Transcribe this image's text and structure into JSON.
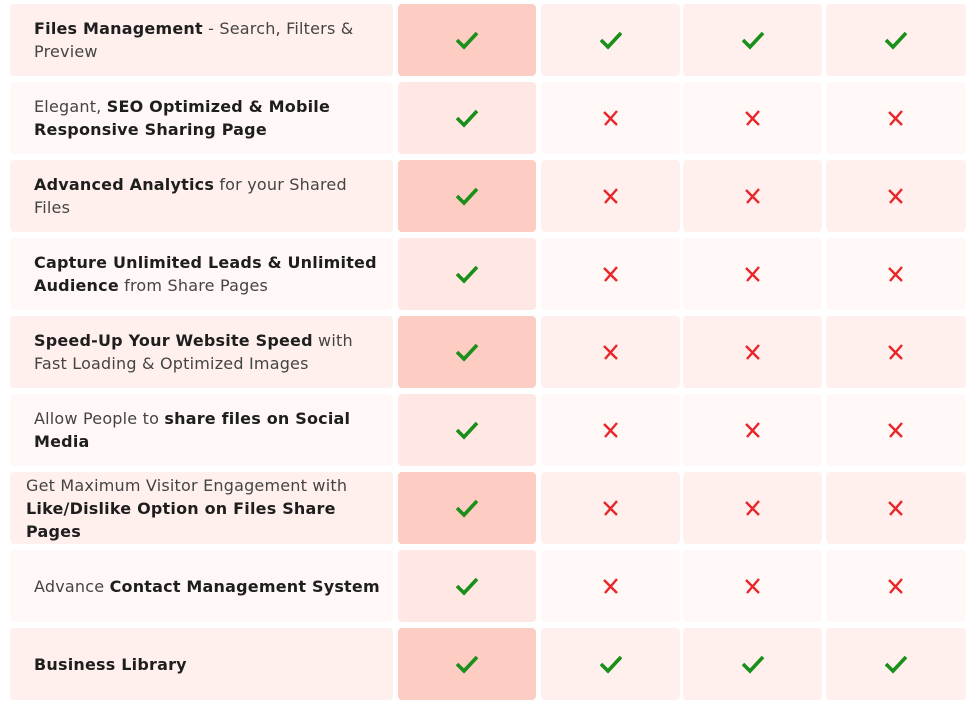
{
  "colors": {
    "check": "#1a8f1a",
    "cross": "#e8262a",
    "highlight_column": "#fdcdc3"
  },
  "rows": [
    {
      "feature": [
        {
          "text": "Files Management",
          "bold": true
        },
        {
          "text": " - Search, Filters & Preview",
          "bold": false
        }
      ],
      "values": [
        "check",
        "check",
        "check",
        "check"
      ]
    },
    {
      "feature": [
        {
          "text": "Elegant, ",
          "bold": false
        },
        {
          "text": "SEO Optimized & Mobile Responsive Sharing Page",
          "bold": true
        }
      ],
      "values": [
        "check",
        "cross",
        "cross",
        "cross"
      ]
    },
    {
      "feature": [
        {
          "text": "Advanced Analytics",
          "bold": true
        },
        {
          "text": " for your Shared Files",
          "bold": false
        }
      ],
      "values": [
        "check",
        "cross",
        "cross",
        "cross"
      ]
    },
    {
      "feature": [
        {
          "text": "Capture Unlimited Leads & Unlimited Audience",
          "bold": true
        },
        {
          "text": " from Share Pages",
          "bold": false
        }
      ],
      "values": [
        "check",
        "cross",
        "cross",
        "cross"
      ]
    },
    {
      "feature": [
        {
          "text": "Speed-Up Your Website Speed",
          "bold": true
        },
        {
          "text": " with Fast Loading & Optimized Images",
          "bold": false
        }
      ],
      "values": [
        "check",
        "cross",
        "cross",
        "cross"
      ]
    },
    {
      "feature": [
        {
          "text": "Allow People to ",
          "bold": false
        },
        {
          "text": "share files on Social Media",
          "bold": true
        }
      ],
      "values": [
        "check",
        "cross",
        "cross",
        "cross"
      ]
    },
    {
      "feature": [
        {
          "text": "Get Maximum Visitor Engagement with ",
          "bold": false
        },
        {
          "text": "Like/Dislike Option on Files Share Pages",
          "bold": true
        }
      ],
      "values": [
        "check",
        "cross",
        "cross",
        "cross"
      ]
    },
    {
      "feature": [
        {
          "text": "Advance ",
          "bold": false
        },
        {
          "text": "Contact Management System",
          "bold": true
        }
      ],
      "values": [
        "check",
        "cross",
        "cross",
        "cross"
      ]
    },
    {
      "feature": [
        {
          "text": "Business Library",
          "bold": true
        }
      ],
      "values": [
        "check",
        "check",
        "check",
        "check"
      ]
    }
  ]
}
